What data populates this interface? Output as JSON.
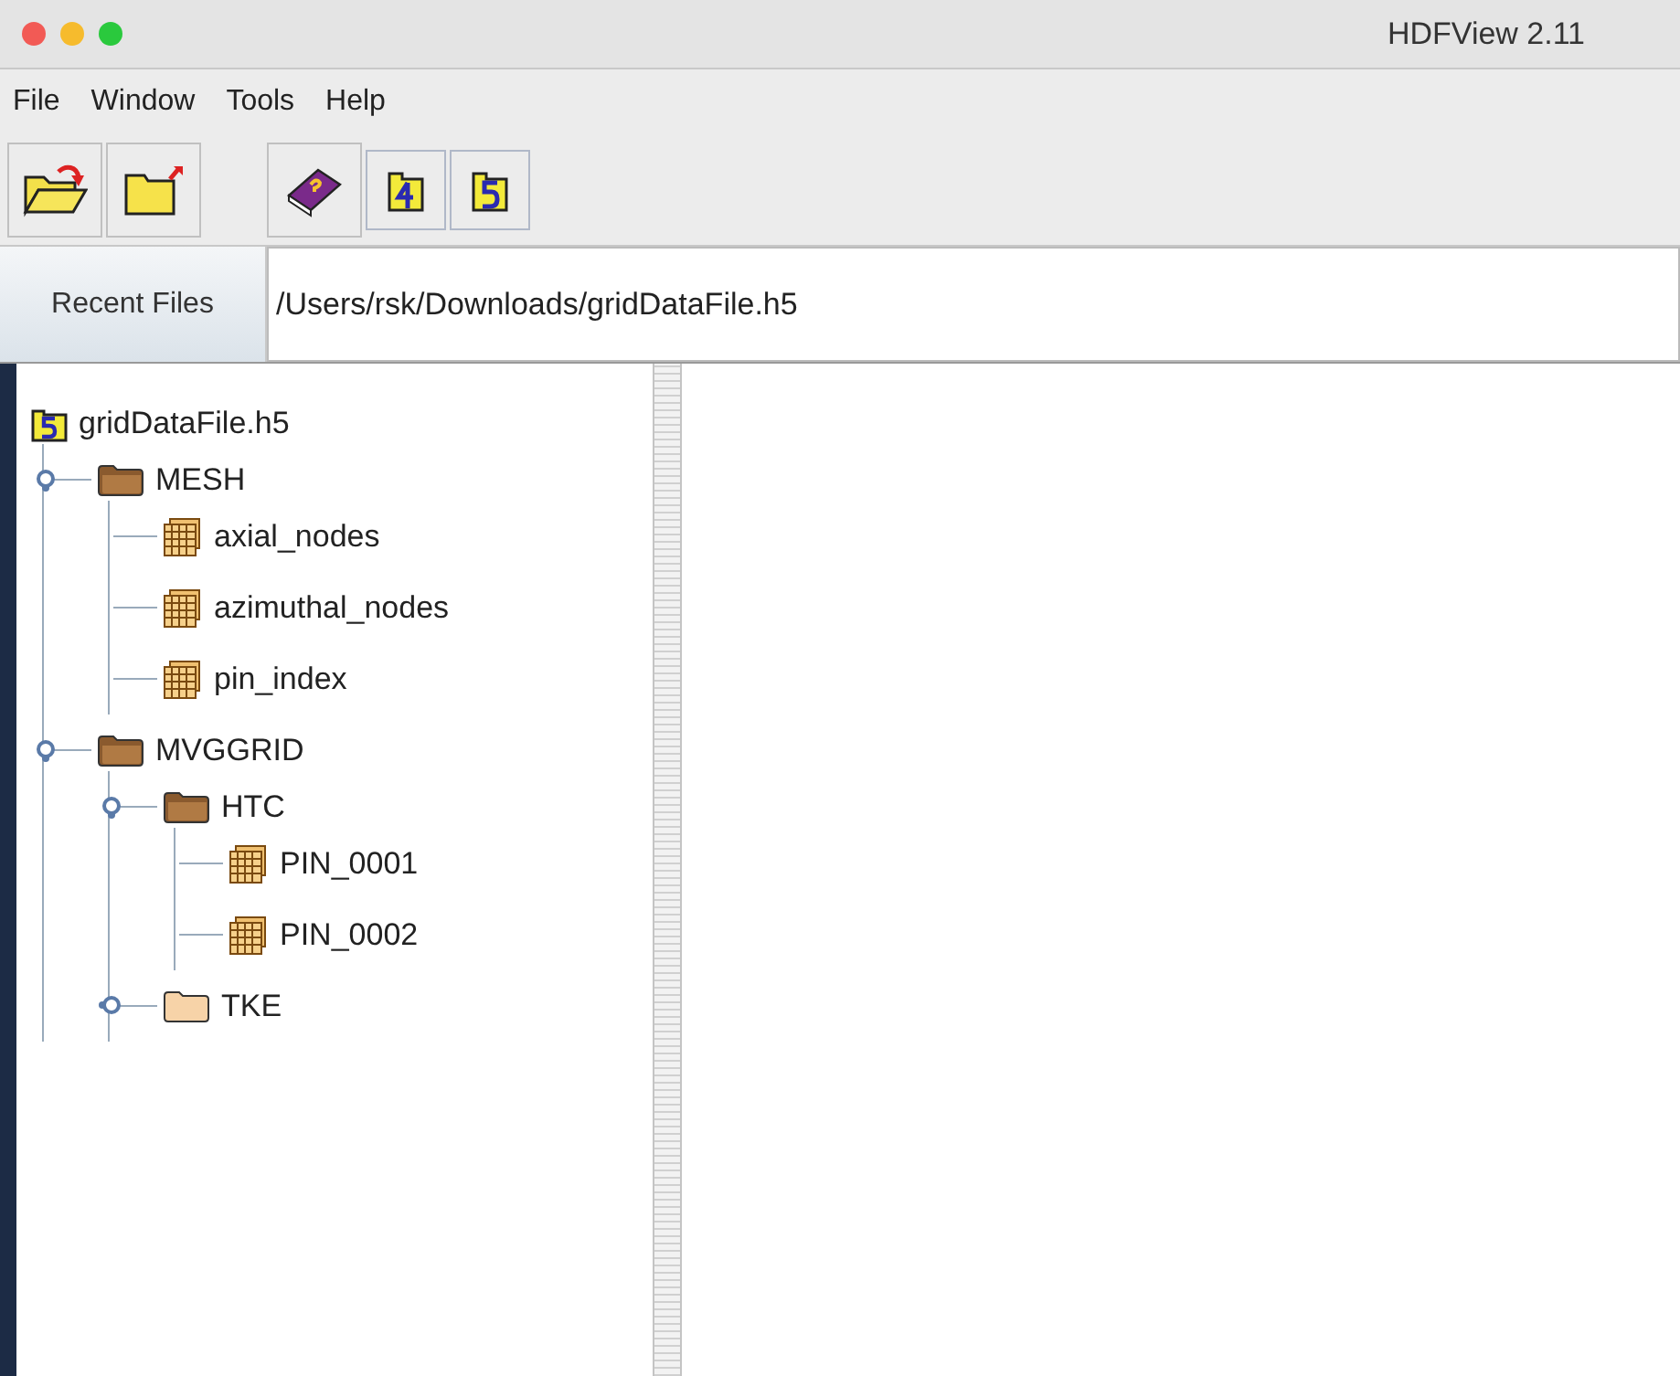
{
  "window": {
    "title": "HDFView 2.11"
  },
  "menu": [
    "File",
    "Window",
    "Tools",
    "Help"
  ],
  "toolbar": [
    {
      "kind": "open"
    },
    {
      "kind": "close"
    },
    {
      "kind": "help"
    },
    {
      "kind": "hdf4"
    },
    {
      "kind": "hdf5"
    }
  ],
  "recent_files": {
    "label": "Recent Files",
    "value": "/Users/rsk/Downloads/gridDataFile.h5"
  },
  "tree": {
    "label": "gridDataFile.h5",
    "kind": "file",
    "children": [
      {
        "label": "MESH",
        "kind": "group",
        "expanded": true,
        "children": [
          {
            "label": "axial_nodes",
            "kind": "dataset"
          },
          {
            "label": "azimuthal_nodes",
            "kind": "dataset"
          },
          {
            "label": "pin_index",
            "kind": "dataset"
          }
        ]
      },
      {
        "label": "MVGGRID",
        "kind": "group",
        "expanded": true,
        "children": [
          {
            "label": "HTC",
            "kind": "group",
            "expanded": true,
            "children": [
              {
                "label": "PIN_0001",
                "kind": "dataset"
              },
              {
                "label": "PIN_0002",
                "kind": "dataset"
              }
            ]
          },
          {
            "label": "TKE",
            "kind": "group",
            "expanded": false
          }
        ]
      }
    ]
  }
}
